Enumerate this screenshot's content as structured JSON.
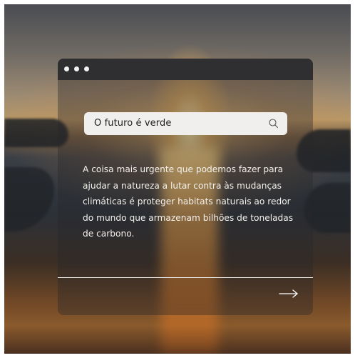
{
  "background": {
    "description_icon": "sunset-water-photo"
  },
  "window": {
    "titlebar_dots": 3,
    "search": {
      "value": "O futuro é verde",
      "icon": "search-icon"
    },
    "body_text": "A coisa mais urgente que podemos fazer para ajudar a natureza a lutar contra às mudanças climáticas é proteger habitats naturais ao redor do mundo que armazenam bilhões de toneladas de carbono.",
    "next_icon": "arrow-right-icon"
  },
  "colors": {
    "titlebar": "#2f2f31",
    "search_bg": "#f1efed",
    "text_light": "#f4f1ec"
  }
}
